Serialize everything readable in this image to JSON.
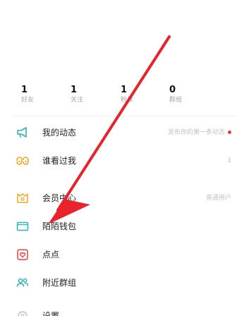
{
  "stats": [
    {
      "value": "1",
      "label": "好友"
    },
    {
      "value": "1",
      "label": "关注"
    },
    {
      "value": "1",
      "label": "粉丝"
    },
    {
      "value": "0",
      "label": "群组"
    }
  ],
  "menu": {
    "dynamic": {
      "label": "我的动态",
      "hint": "发布你的第一条动态",
      "icon": "megaphone-icon"
    },
    "visitors": {
      "label": "谁看过我",
      "count": "1",
      "icon": "eyes-icon"
    },
    "member": {
      "label": "会员中心",
      "hint": "普通用户",
      "icon": "member-card-icon"
    },
    "wallet": {
      "label": "陌陌钱包",
      "icon": "wallet-icon"
    },
    "dots": {
      "label": "点点",
      "icon": "heart-card-icon"
    },
    "groups": {
      "label": "附近群组",
      "icon": "group-icon"
    },
    "settings": {
      "label": "设置",
      "icon": "gear-icon"
    }
  },
  "colors": {
    "accent_orange": "#f5a623",
    "accent_teal": "#2bb5b0",
    "accent_red": "#ee3b3b",
    "arrow_red": "#e8232b"
  }
}
